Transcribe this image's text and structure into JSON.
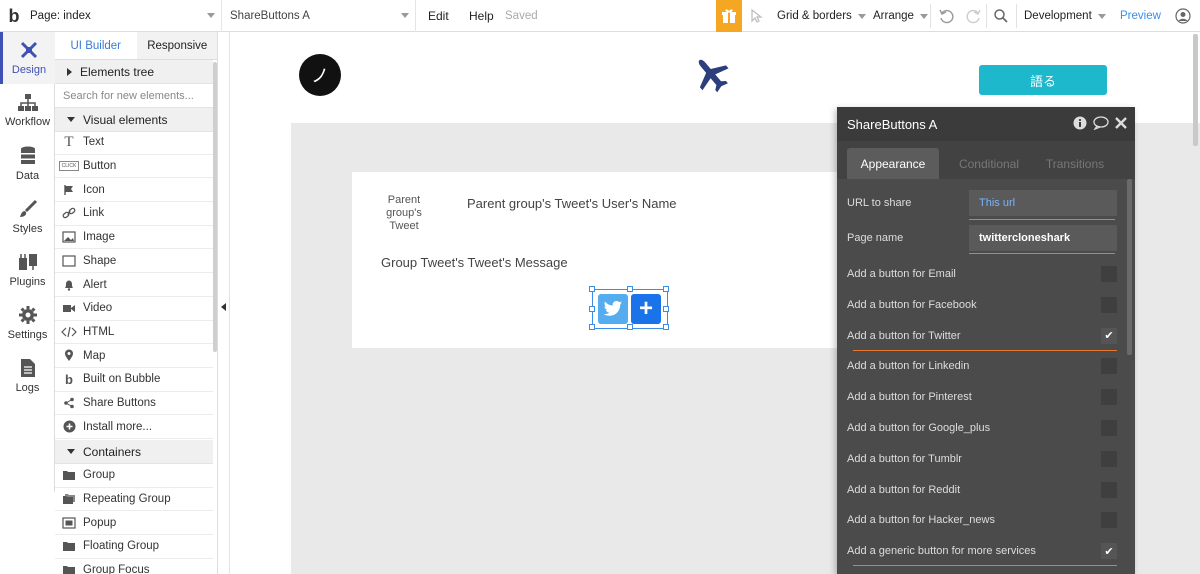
{
  "topbar": {
    "logo": "b",
    "page": "Page: index",
    "element": "ShareButtons A",
    "edit": "Edit",
    "help": "Help",
    "saved": "Saved",
    "grid": "Grid & borders",
    "arrange": "Arrange",
    "version": "Development",
    "preview": "Preview"
  },
  "nav": {
    "design": "Design",
    "workflow": "Workflow",
    "data": "Data",
    "styles": "Styles",
    "plugins": "Plugins",
    "settings": "Settings",
    "logs": "Logs"
  },
  "palette": {
    "tab_builder": "UI Builder",
    "tab_responsive": "Responsive",
    "elements_tree": "Elements tree",
    "search_placeholder": "Search for new elements...",
    "visual_header": "Visual elements",
    "visual_items": [
      {
        "label": "Text",
        "icon": "text-icon"
      },
      {
        "label": "Button",
        "icon": "button-icon"
      },
      {
        "label": "Icon",
        "icon": "flag-icon"
      },
      {
        "label": "Link",
        "icon": "link-icon"
      },
      {
        "label": "Image",
        "icon": "image-icon"
      },
      {
        "label": "Shape",
        "icon": "shape-icon"
      },
      {
        "label": "Alert",
        "icon": "bell-icon"
      },
      {
        "label": "Video",
        "icon": "video-icon"
      },
      {
        "label": "HTML",
        "icon": "code-icon"
      },
      {
        "label": "Map",
        "icon": "map-pin-icon"
      },
      {
        "label": "Built on Bubble",
        "icon": "bubble-logo-icon"
      },
      {
        "label": "Share Buttons",
        "icon": "share-icon"
      },
      {
        "label": "Install more...",
        "icon": "plus-circle-icon"
      }
    ],
    "containers_header": "Containers",
    "container_items": [
      {
        "label": "Group",
        "icon": "folder-icon"
      },
      {
        "label": "Repeating Group",
        "icon": "folders-icon"
      },
      {
        "label": "Popup",
        "icon": "popup-icon"
      },
      {
        "label": "Floating Group",
        "icon": "folder-icon"
      },
      {
        "label": "Group Focus",
        "icon": "folder-icon"
      }
    ],
    "button_icon_text": "CLICK"
  },
  "canvas": {
    "circle_btn": "ノ",
    "talk_btn": "語る",
    "img_placeholder": "Parent group's Tweet",
    "user_name": "Parent group's Tweet's User's Name",
    "message": "Group Tweet's Tweet's Message",
    "plus_label": "+"
  },
  "property_editor": {
    "title": "ShareButtons A",
    "tabs": [
      "Appearance",
      "Conditional",
      "Transitions"
    ],
    "url_label": "URL to share",
    "url_value": "This url",
    "page_name_label": "Page name",
    "page_name_value": "twittercloneshark",
    "checkboxes": [
      {
        "label": "Add a button for Email",
        "checked": false
      },
      {
        "label": "Add a button for Facebook",
        "checked": false
      },
      {
        "label": "Add a button for Twitter",
        "checked": true
      },
      {
        "label": "Add a button for Linkedin",
        "checked": false
      },
      {
        "label": "Add a button for Pinterest",
        "checked": false
      },
      {
        "label": "Add a button for Google_plus",
        "checked": false
      },
      {
        "label": "Add a button for Tumblr",
        "checked": false
      },
      {
        "label": "Add a button for Reddit",
        "checked": false
      },
      {
        "label": "Add a button for Hacker_news",
        "checked": false
      },
      {
        "label": "Add a generic button for more services",
        "checked": true
      }
    ],
    "checkmark": "✔"
  },
  "colors": {
    "accent": "#3a8ee6",
    "teal_button": "#1eb8cc",
    "orange": "#e8772e",
    "gift": "#f5a623",
    "twitter": "#55acee",
    "panel": "#4b4b4b"
  }
}
